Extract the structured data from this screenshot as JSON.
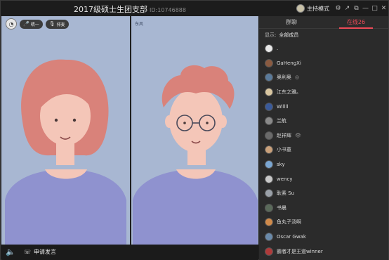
{
  "window": {
    "title": "2017级硕士生团支部",
    "room_id": "ID:10746888",
    "host_mode": "主持模式",
    "icons": [
      "settings-icon",
      "share-icon",
      "popout-icon",
      "minimize-icon",
      "maximize-icon",
      "close-icon"
    ]
  },
  "left_pane": {
    "user_label": "晴一",
    "queue_label": "排麦"
  },
  "right_pane": {
    "label": "东风"
  },
  "bottom_bar": {
    "apply_label": "申请发言"
  },
  "sidebar": {
    "tabs": [
      "群聊",
      "在线26"
    ],
    "active_tab": 1,
    "filter_label": "显示:",
    "filter_value": "全部成员",
    "members": [
      {
        "name": ".",
        "avatar_color": "#e8e8e8",
        "badge": ""
      },
      {
        "name": "GaHengXi",
        "avatar_color": "#8a5a40",
        "badge": ""
      },
      {
        "name": "奥利奥",
        "avatar_color": "#5a7a9a",
        "badge": "◎"
      },
      {
        "name": "江东之雅。",
        "avatar_color": "#d9c6a0",
        "badge": ""
      },
      {
        "name": "Willll",
        "avatar_color": "#3a5a9a",
        "badge": ""
      },
      {
        "name": "兰航",
        "avatar_color": "#8a8a8a",
        "badge": ""
      },
      {
        "name": "赵祥辉",
        "avatar_color": "#6a6a6a",
        "badge": "👁"
      },
      {
        "name": "小书童",
        "avatar_color": "#c9a07a",
        "badge": ""
      },
      {
        "name": "sky",
        "avatar_color": "#7aa6d2",
        "badge": ""
      },
      {
        "name": "wency",
        "avatar_color": "#c8c8c8",
        "badge": ""
      },
      {
        "name": "耿素 Su",
        "avatar_color": "#9aa0a8",
        "badge": ""
      },
      {
        "name": "书晨",
        "avatar_color": "#5a6a5a",
        "badge": ""
      },
      {
        "name": "鱼丸子汤啊",
        "avatar_color": "#d08a4a",
        "badge": ""
      },
      {
        "name": "Oscar Gwak",
        "avatar_color": "#6a8aaa",
        "badge": ""
      },
      {
        "name": "霸者才是王道winner",
        "avatar_color": "#b03a3a",
        "badge": ""
      }
    ]
  },
  "colors": {
    "accent": "#ee4a58",
    "video_bg": "#a8b7d2"
  }
}
